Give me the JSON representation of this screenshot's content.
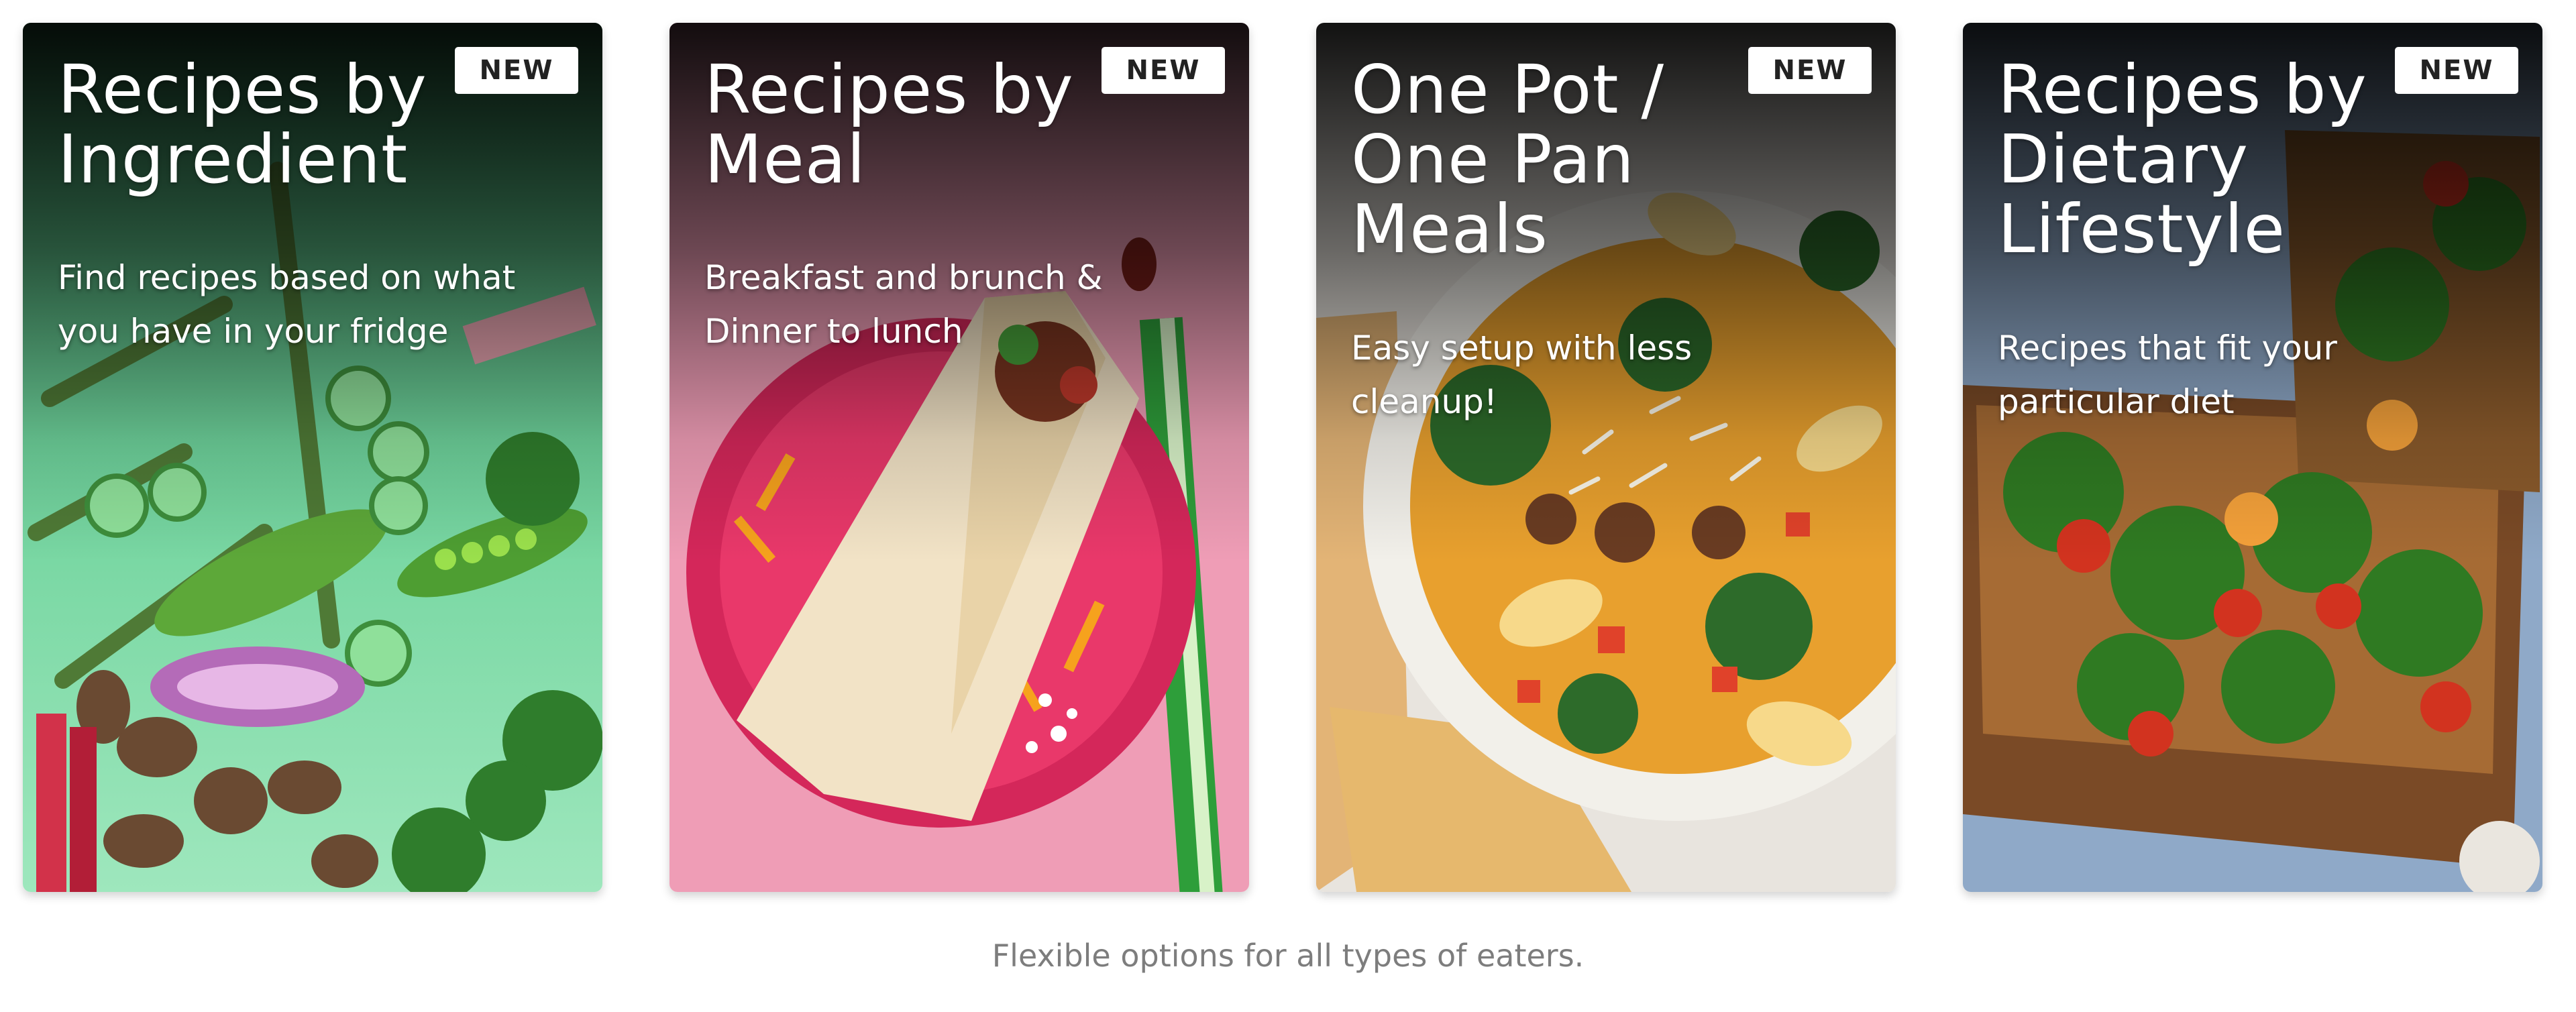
{
  "cards": [
    {
      "badge": "NEW",
      "title_lines": [
        "Recipes by",
        "Ingredient"
      ],
      "description_lines": [
        "Find recipes based on what",
        "you have in your fridge"
      ],
      "photo_icon": "vegetables-photo",
      "colors": {
        "background": "#6fd39c"
      }
    },
    {
      "badge": "NEW",
      "title_lines": [
        "Recipes by",
        "Meal"
      ],
      "description_lines": [
        "Breakfast and brunch &",
        "Dinner to lunch"
      ],
      "photo_icon": "wrap-on-plate-photo",
      "colors": {
        "background": "#ef9db6",
        "plate": "#e9386a"
      }
    },
    {
      "badge": "NEW",
      "title_lines": [
        "One Pot /",
        "One Pan",
        "Meals"
      ],
      "description_lines": [
        "Easy setup with less",
        "cleanup!"
      ],
      "photo_icon": "pasta-bowl-photo",
      "colors": {
        "bowl": "#f2f0ea"
      }
    },
    {
      "badge": "NEW",
      "title_lines": [
        "Recipes by",
        "Dietary",
        "Lifestyle"
      ],
      "description_lines": [
        "Recipes that fit your",
        "particular diet"
      ],
      "photo_icon": "flatbread-pizza-photo",
      "colors": {
        "tablecloth": "#8fa9c8",
        "board": "#7a4a26"
      }
    }
  ],
  "caption": "Flexible options for all types of eaters."
}
